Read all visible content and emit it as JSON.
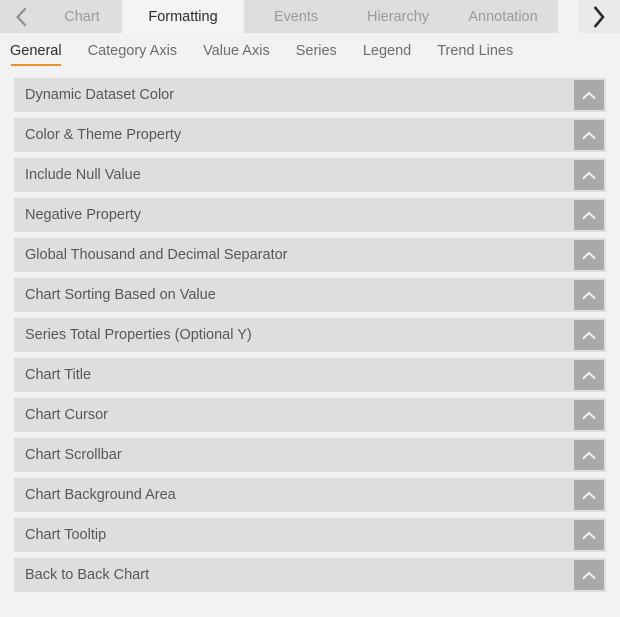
{
  "tabstrip": {
    "prev_arrow_icon": "chevron-left-icon",
    "next_arrow_icon": "chevron-right-icon",
    "tabs": [
      {
        "label": "Chart",
        "active": false
      },
      {
        "label": "Formatting",
        "active": true
      },
      {
        "label": "Events",
        "active": false
      },
      {
        "label": "Hierarchy",
        "active": false
      },
      {
        "label": "Annotation",
        "active": false
      }
    ]
  },
  "subtabs": {
    "active_underline_color": "#e8912d",
    "items": [
      {
        "label": "General",
        "active": true
      },
      {
        "label": "Category Axis",
        "active": false
      },
      {
        "label": "Value Axis",
        "active": false
      },
      {
        "label": "Series",
        "active": false
      },
      {
        "label": "Legend",
        "active": false
      },
      {
        "label": "Trend Lines",
        "active": false
      }
    ]
  },
  "panels": {
    "toggle_icon": "chevron-up-icon",
    "row_color": "#dedede",
    "toggle_color": "#a9a9a9",
    "items": [
      {
        "label": "Dynamic Dataset Color"
      },
      {
        "label": "Color & Theme Property"
      },
      {
        "label": "Include Null Value"
      },
      {
        "label": "Negative Property"
      },
      {
        "label": "Global Thousand and Decimal Separator"
      },
      {
        "label": "Chart Sorting Based on Value"
      },
      {
        "label": "Series Total Properties (Optional Y)"
      },
      {
        "label": "Chart Title"
      },
      {
        "label": "Chart Cursor"
      },
      {
        "label": "Chart Scrollbar"
      },
      {
        "label": "Chart Background Area"
      },
      {
        "label": "Chart Tooltip"
      },
      {
        "label": "Back to Back Chart"
      }
    ]
  }
}
